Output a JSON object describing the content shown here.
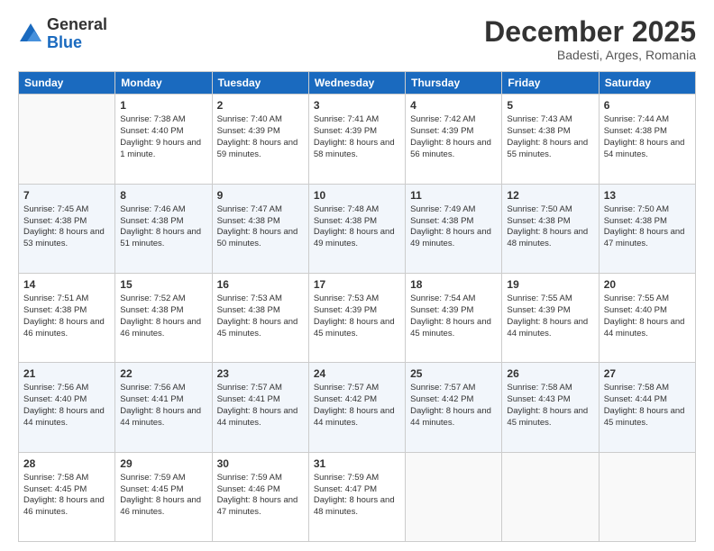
{
  "header": {
    "logo_general": "General",
    "logo_blue": "Blue",
    "month_title": "December 2025",
    "location": "Badesti, Arges, Romania"
  },
  "days_of_week": [
    "Sunday",
    "Monday",
    "Tuesday",
    "Wednesday",
    "Thursday",
    "Friday",
    "Saturday"
  ],
  "weeks": [
    [
      {
        "day": "",
        "sunrise": "",
        "sunset": "",
        "daylight": ""
      },
      {
        "day": "1",
        "sunrise": "Sunrise: 7:38 AM",
        "sunset": "Sunset: 4:40 PM",
        "daylight": "Daylight: 9 hours and 1 minute."
      },
      {
        "day": "2",
        "sunrise": "Sunrise: 7:40 AM",
        "sunset": "Sunset: 4:39 PM",
        "daylight": "Daylight: 8 hours and 59 minutes."
      },
      {
        "day": "3",
        "sunrise": "Sunrise: 7:41 AM",
        "sunset": "Sunset: 4:39 PM",
        "daylight": "Daylight: 8 hours and 58 minutes."
      },
      {
        "day": "4",
        "sunrise": "Sunrise: 7:42 AM",
        "sunset": "Sunset: 4:39 PM",
        "daylight": "Daylight: 8 hours and 56 minutes."
      },
      {
        "day": "5",
        "sunrise": "Sunrise: 7:43 AM",
        "sunset": "Sunset: 4:38 PM",
        "daylight": "Daylight: 8 hours and 55 minutes."
      },
      {
        "day": "6",
        "sunrise": "Sunrise: 7:44 AM",
        "sunset": "Sunset: 4:38 PM",
        "daylight": "Daylight: 8 hours and 54 minutes."
      }
    ],
    [
      {
        "day": "7",
        "sunrise": "Sunrise: 7:45 AM",
        "sunset": "Sunset: 4:38 PM",
        "daylight": "Daylight: 8 hours and 53 minutes."
      },
      {
        "day": "8",
        "sunrise": "Sunrise: 7:46 AM",
        "sunset": "Sunset: 4:38 PM",
        "daylight": "Daylight: 8 hours and 51 minutes."
      },
      {
        "day": "9",
        "sunrise": "Sunrise: 7:47 AM",
        "sunset": "Sunset: 4:38 PM",
        "daylight": "Daylight: 8 hours and 50 minutes."
      },
      {
        "day": "10",
        "sunrise": "Sunrise: 7:48 AM",
        "sunset": "Sunset: 4:38 PM",
        "daylight": "Daylight: 8 hours and 49 minutes."
      },
      {
        "day": "11",
        "sunrise": "Sunrise: 7:49 AM",
        "sunset": "Sunset: 4:38 PM",
        "daylight": "Daylight: 8 hours and 49 minutes."
      },
      {
        "day": "12",
        "sunrise": "Sunrise: 7:50 AM",
        "sunset": "Sunset: 4:38 PM",
        "daylight": "Daylight: 8 hours and 48 minutes."
      },
      {
        "day": "13",
        "sunrise": "Sunrise: 7:50 AM",
        "sunset": "Sunset: 4:38 PM",
        "daylight": "Daylight: 8 hours and 47 minutes."
      }
    ],
    [
      {
        "day": "14",
        "sunrise": "Sunrise: 7:51 AM",
        "sunset": "Sunset: 4:38 PM",
        "daylight": "Daylight: 8 hours and 46 minutes."
      },
      {
        "day": "15",
        "sunrise": "Sunrise: 7:52 AM",
        "sunset": "Sunset: 4:38 PM",
        "daylight": "Daylight: 8 hours and 46 minutes."
      },
      {
        "day": "16",
        "sunrise": "Sunrise: 7:53 AM",
        "sunset": "Sunset: 4:38 PM",
        "daylight": "Daylight: 8 hours and 45 minutes."
      },
      {
        "day": "17",
        "sunrise": "Sunrise: 7:53 AM",
        "sunset": "Sunset: 4:39 PM",
        "daylight": "Daylight: 8 hours and 45 minutes."
      },
      {
        "day": "18",
        "sunrise": "Sunrise: 7:54 AM",
        "sunset": "Sunset: 4:39 PM",
        "daylight": "Daylight: 8 hours and 45 minutes."
      },
      {
        "day": "19",
        "sunrise": "Sunrise: 7:55 AM",
        "sunset": "Sunset: 4:39 PM",
        "daylight": "Daylight: 8 hours and 44 minutes."
      },
      {
        "day": "20",
        "sunrise": "Sunrise: 7:55 AM",
        "sunset": "Sunset: 4:40 PM",
        "daylight": "Daylight: 8 hours and 44 minutes."
      }
    ],
    [
      {
        "day": "21",
        "sunrise": "Sunrise: 7:56 AM",
        "sunset": "Sunset: 4:40 PM",
        "daylight": "Daylight: 8 hours and 44 minutes."
      },
      {
        "day": "22",
        "sunrise": "Sunrise: 7:56 AM",
        "sunset": "Sunset: 4:41 PM",
        "daylight": "Daylight: 8 hours and 44 minutes."
      },
      {
        "day": "23",
        "sunrise": "Sunrise: 7:57 AM",
        "sunset": "Sunset: 4:41 PM",
        "daylight": "Daylight: 8 hours and 44 minutes."
      },
      {
        "day": "24",
        "sunrise": "Sunrise: 7:57 AM",
        "sunset": "Sunset: 4:42 PM",
        "daylight": "Daylight: 8 hours and 44 minutes."
      },
      {
        "day": "25",
        "sunrise": "Sunrise: 7:57 AM",
        "sunset": "Sunset: 4:42 PM",
        "daylight": "Daylight: 8 hours and 44 minutes."
      },
      {
        "day": "26",
        "sunrise": "Sunrise: 7:58 AM",
        "sunset": "Sunset: 4:43 PM",
        "daylight": "Daylight: 8 hours and 45 minutes."
      },
      {
        "day": "27",
        "sunrise": "Sunrise: 7:58 AM",
        "sunset": "Sunset: 4:44 PM",
        "daylight": "Daylight: 8 hours and 45 minutes."
      }
    ],
    [
      {
        "day": "28",
        "sunrise": "Sunrise: 7:58 AM",
        "sunset": "Sunset: 4:45 PM",
        "daylight": "Daylight: 8 hours and 46 minutes."
      },
      {
        "day": "29",
        "sunrise": "Sunrise: 7:59 AM",
        "sunset": "Sunset: 4:45 PM",
        "daylight": "Daylight: 8 hours and 46 minutes."
      },
      {
        "day": "30",
        "sunrise": "Sunrise: 7:59 AM",
        "sunset": "Sunset: 4:46 PM",
        "daylight": "Daylight: 8 hours and 47 minutes."
      },
      {
        "day": "31",
        "sunrise": "Sunrise: 7:59 AM",
        "sunset": "Sunset: 4:47 PM",
        "daylight": "Daylight: 8 hours and 48 minutes."
      },
      {
        "day": "",
        "sunrise": "",
        "sunset": "",
        "daylight": ""
      },
      {
        "day": "",
        "sunrise": "",
        "sunset": "",
        "daylight": ""
      },
      {
        "day": "",
        "sunrise": "",
        "sunset": "",
        "daylight": ""
      }
    ]
  ]
}
